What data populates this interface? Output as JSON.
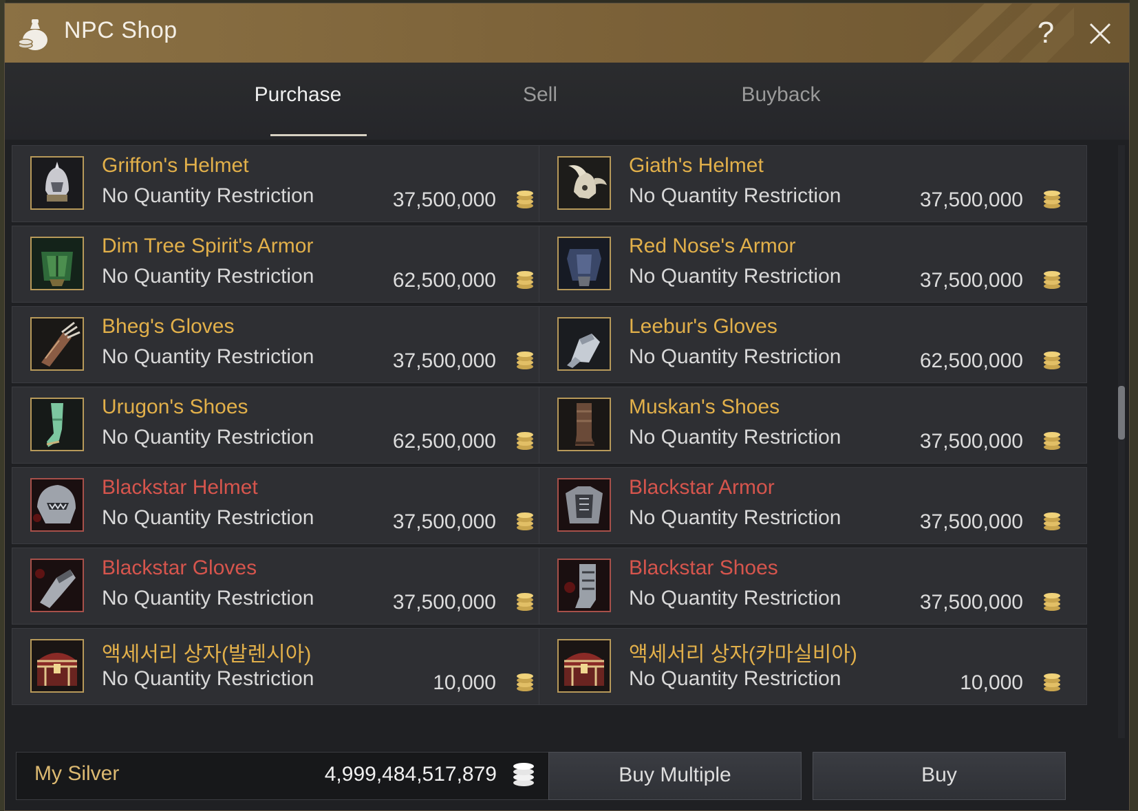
{
  "window": {
    "title": "NPC Shop",
    "help_glyph": "?"
  },
  "tabs": [
    {
      "label": "Purchase",
      "active": true
    },
    {
      "label": "Sell",
      "active": false
    },
    {
      "label": "Buyback",
      "active": false
    }
  ],
  "items": [
    {
      "name": "Griffon's Helmet",
      "restriction": "No Quantity Restriction",
      "price": "37,500,000",
      "icon": "helmet-icon",
      "tier": "gold"
    },
    {
      "name": "Giath's Helmet",
      "restriction": "No Quantity Restriction",
      "price": "37,500,000",
      "icon": "horned-helmet-icon",
      "tier": "gold"
    },
    {
      "name": "Dim Tree Spirit's Armor",
      "restriction": "No Quantity Restriction",
      "price": "62,500,000",
      "icon": "leaf-armor-icon",
      "tier": "gold"
    },
    {
      "name": "Red Nose's Armor",
      "restriction": "No Quantity Restriction",
      "price": "37,500,000",
      "icon": "plate-armor-icon",
      "tier": "gold"
    },
    {
      "name": "Bheg's Gloves",
      "restriction": "No Quantity Restriction",
      "price": "37,500,000",
      "icon": "claw-gloves-icon",
      "tier": "gold"
    },
    {
      "name": "Leebur's Gloves",
      "restriction": "No Quantity Restriction",
      "price": "62,500,000",
      "icon": "gauntlet-icon",
      "tier": "gold"
    },
    {
      "name": "Urugon's Shoes",
      "restriction": "No Quantity Restriction",
      "price": "62,500,000",
      "icon": "green-boot-icon",
      "tier": "gold"
    },
    {
      "name": "Muskan's Shoes",
      "restriction": "No Quantity Restriction",
      "price": "37,500,000",
      "icon": "leather-boot-icon",
      "tier": "gold"
    },
    {
      "name": "Blackstar Helmet",
      "restriction": "No Quantity Restriction",
      "price": "37,500,000",
      "icon": "blackstar-helmet-icon",
      "tier": "red"
    },
    {
      "name": "Blackstar Armor",
      "restriction": "No Quantity Restriction",
      "price": "37,500,000",
      "icon": "blackstar-armor-icon",
      "tier": "red"
    },
    {
      "name": "Blackstar Gloves",
      "restriction": "No Quantity Restriction",
      "price": "37,500,000",
      "icon": "blackstar-gloves-icon",
      "tier": "red"
    },
    {
      "name": "Blackstar Shoes",
      "restriction": "No Quantity Restriction",
      "price": "37,500,000",
      "icon": "blackstar-shoes-icon",
      "tier": "red"
    },
    {
      "name": "액세서리 상자(발렌시아)",
      "restriction": "No Quantity Restriction",
      "price": "10,000",
      "icon": "treasure-chest-icon",
      "tier": "gold"
    },
    {
      "name": "액세서리 상자(카마실비아)",
      "restriction": "No Quantity Restriction",
      "price": "10,000",
      "icon": "treasure-chest-icon",
      "tier": "gold"
    }
  ],
  "footer": {
    "silver_label": "My Silver",
    "silver_value": "4,999,484,517,879",
    "buy_multiple_label": "Buy Multiple",
    "buy_label": "Buy"
  },
  "colors": {
    "gold_name": "#e2b04a",
    "red_name": "#d6554d",
    "title_bar": "#8b7144"
  }
}
